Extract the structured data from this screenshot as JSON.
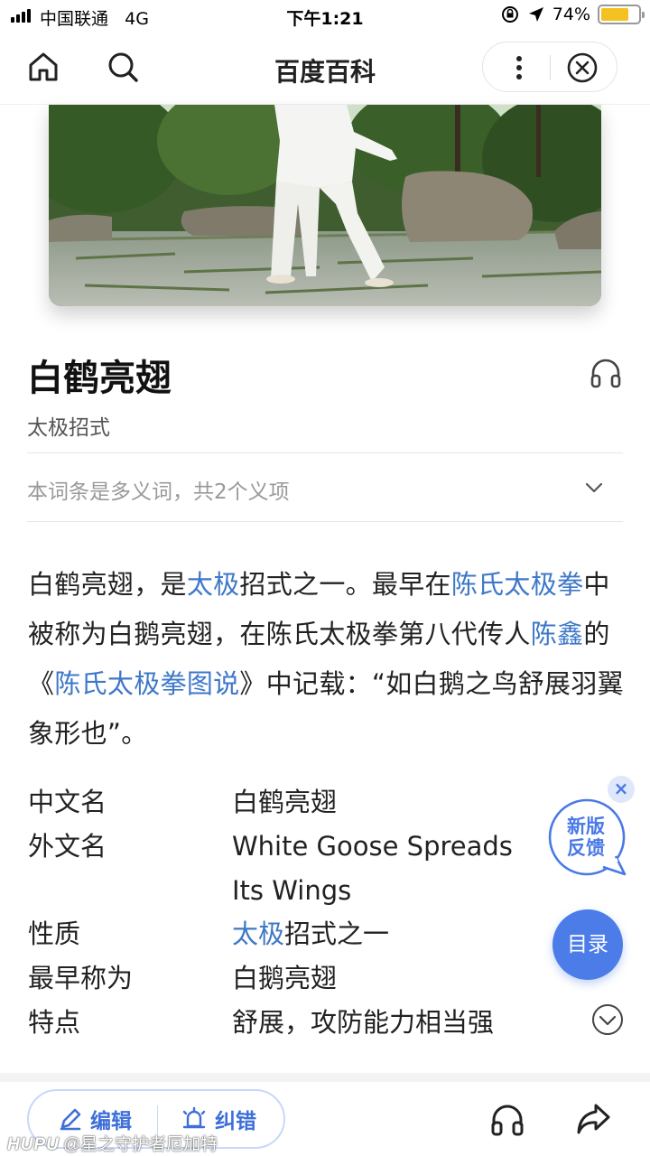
{
  "status_bar": {
    "carrier": "中国联通",
    "network": "4G",
    "time": "下午1:21",
    "battery": "74%",
    "battery_level": 0.74
  },
  "nav": {
    "title": "百度百科"
  },
  "entry": {
    "title": "白鹤亮翅",
    "subtitle": "太极招式",
    "polysemy": "本词条是多义词，共2个义项",
    "summary": {
      "p1": "白鹤亮翅，是",
      "link1": "太极",
      "p2": "招式之一。最早在",
      "link2": "陈氏太极拳",
      "p3": "中被称为白鹅亮翅，在陈氏太极拳第八代传人",
      "link3": "陈鑫",
      "p4": "的《",
      "link4": "陈氏太极拳图说",
      "p5": "》中记载：“如白鹅之鸟舒展羽翼象形也”。"
    },
    "info": [
      {
        "key": "中文名",
        "value": "白鹤亮翅"
      },
      {
        "key": "外文名",
        "value": "White Goose Spreads Its Wings"
      },
      {
        "key": "性质",
        "value_link": "太极",
        "value": "招式之一"
      },
      {
        "key": "最早称为",
        "value": "白鹅亮翅"
      },
      {
        "key": "特点",
        "value": "舒展，攻防能力相当强"
      }
    ]
  },
  "floating": {
    "feedback_line1": "新版",
    "feedback_line2": "反馈",
    "toc": "目录"
  },
  "bottom_bar": {
    "edit": "编辑",
    "correct": "纠错"
  },
  "watermark": {
    "brand": "HUPU",
    "user": "@星之守护者厄加特"
  },
  "colors": {
    "link": "#3e78c8",
    "accent": "#4b7ce8",
    "battery": "#f3c221"
  }
}
